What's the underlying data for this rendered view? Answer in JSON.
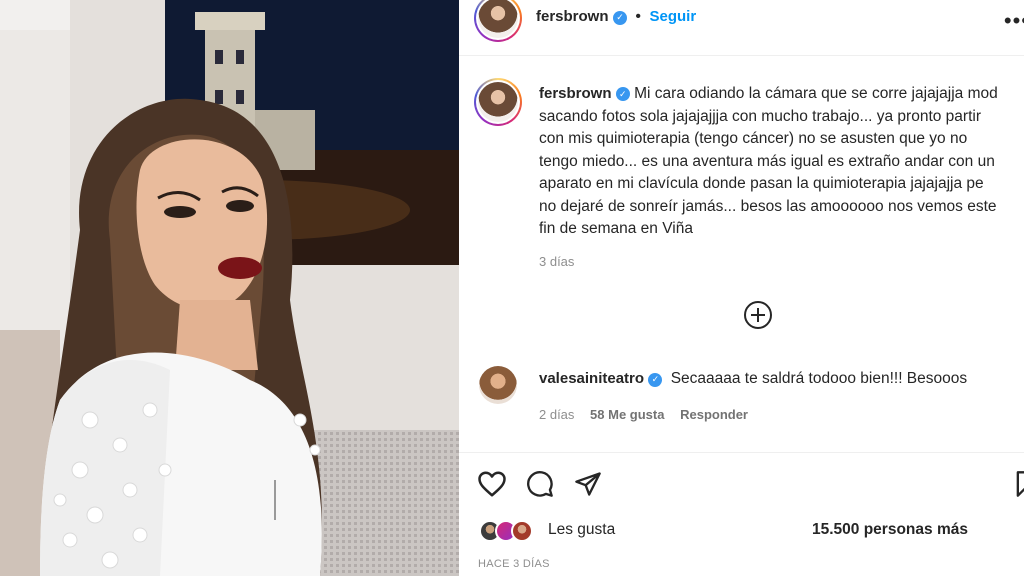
{
  "post": {
    "username": "fersbrown",
    "follow_label": "Seguir",
    "more_label": "•••"
  },
  "caption": {
    "username": "fersbrown",
    "lines": [
      "Mi cara odiando la cámara que se corre jajajajja mod",
      "sacando fotos sola jajajajjja con mucho trabajo... ya pronto partir",
      "con mis quimioterapia (tengo cáncer) no se asusten que yo no",
      "tengo miedo... es una aventura más igual es extraño andar con un",
      "aparato en mi clavícula donde pasan la quimioterapia jajajajja pe",
      "no dejaré de sonreír jamás... besos las amoooooo nos vemos este",
      "fin de semana en Viña"
    ],
    "time": "3 días"
  },
  "comment": {
    "username": "valesainiteatro",
    "text": "Secaaaaa te saldrá todooo bien!!! Besooos",
    "time": "2 días",
    "likes": "58 Me gusta",
    "reply_label": "Responder"
  },
  "likes": {
    "prefix": "Les gusta",
    "count": "15.500 personas más"
  },
  "timestamp": "HACE 3 DÍAS",
  "icons": {
    "like": "heart-icon",
    "comment": "comment-icon",
    "share": "share-icon",
    "save": "bookmark-icon",
    "add": "plus-circle-icon"
  },
  "colors": {
    "link": "#0095f6",
    "verified": "#3897f0",
    "muted": "#8e8e8e"
  }
}
